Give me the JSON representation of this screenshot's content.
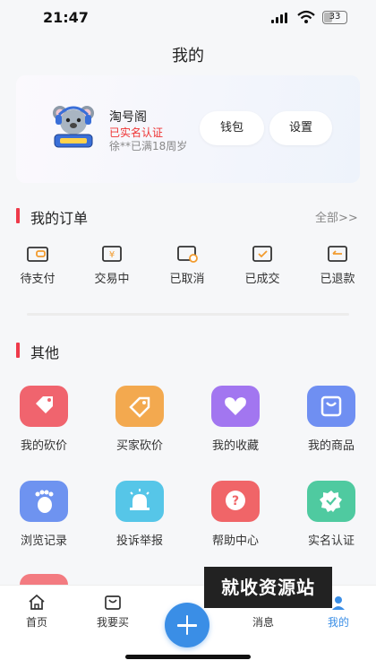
{
  "status": {
    "time": "21:47",
    "battery": "33"
  },
  "page_title": "我的",
  "profile": {
    "name": "淘号阁",
    "verified": "已实名认证",
    "sub": "徐**已满18周岁",
    "wallet_label": "钱包",
    "settings_label": "设置"
  },
  "orders": {
    "title": "我的订单",
    "all_label": "全部>>",
    "items": [
      {
        "label": "待支付"
      },
      {
        "label": "交易中"
      },
      {
        "label": "已取消"
      },
      {
        "label": "已成交"
      },
      {
        "label": "已退款"
      }
    ]
  },
  "others": {
    "title": "其他",
    "items": [
      {
        "label": "我的砍价",
        "icon": "tag-icon",
        "color": "#f0646e"
      },
      {
        "label": "买家砍价",
        "icon": "price-tag-icon",
        "color": "#f3a94f"
      },
      {
        "label": "我的收藏",
        "icon": "heart-icon",
        "color": "#a276f0"
      },
      {
        "label": "我的商品",
        "icon": "shop-bag-icon",
        "color": "#6f8ff2"
      },
      {
        "label": "浏览记录",
        "icon": "footprint-icon",
        "color": "#6e93f0"
      },
      {
        "label": "投诉举报",
        "icon": "alarm-icon",
        "color": "#56c6e8"
      },
      {
        "label": "帮助中心",
        "icon": "help-icon",
        "color": "#f06568"
      },
      {
        "label": "实名认证",
        "icon": "verified-icon",
        "color": "#4fcaa0"
      }
    ]
  },
  "tabs": [
    {
      "label": "首页"
    },
    {
      "label": "我要买"
    },
    {
      "label": "消息"
    },
    {
      "label": "我的"
    }
  ],
  "colors": {
    "accent": "#ee3a4a",
    "active_tab": "#3a8ee6",
    "plus_button": "#3a8ee6"
  },
  "watermark": "就收资源站"
}
